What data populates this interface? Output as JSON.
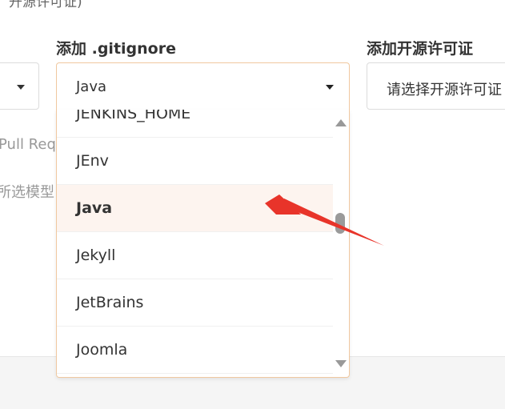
{
  "top_clip_text": "、开源许可证)",
  "gitignore": {
    "label": "添加 .gitignore",
    "selected_value": "Java",
    "options": [
      "JENKINS_HOME",
      "JEnv",
      "Java",
      "Jekyll",
      "JetBrains",
      "Joomla"
    ],
    "selected_index": 2,
    "scroll_position": 0.48
  },
  "license": {
    "label": "添加开源许可证",
    "placeholder": "请选择开源许可证"
  },
  "side": {
    "pull_text": "Pull Req",
    "model_text": "所选模型"
  },
  "colors": {
    "focus_border": "#f0c8a0",
    "selected_bg": "#fdf4ef",
    "annotation_arrow": "#e8342a"
  },
  "icons": [
    "chevron-down-icon",
    "scroll-up-icon",
    "scroll-down-icon"
  ]
}
